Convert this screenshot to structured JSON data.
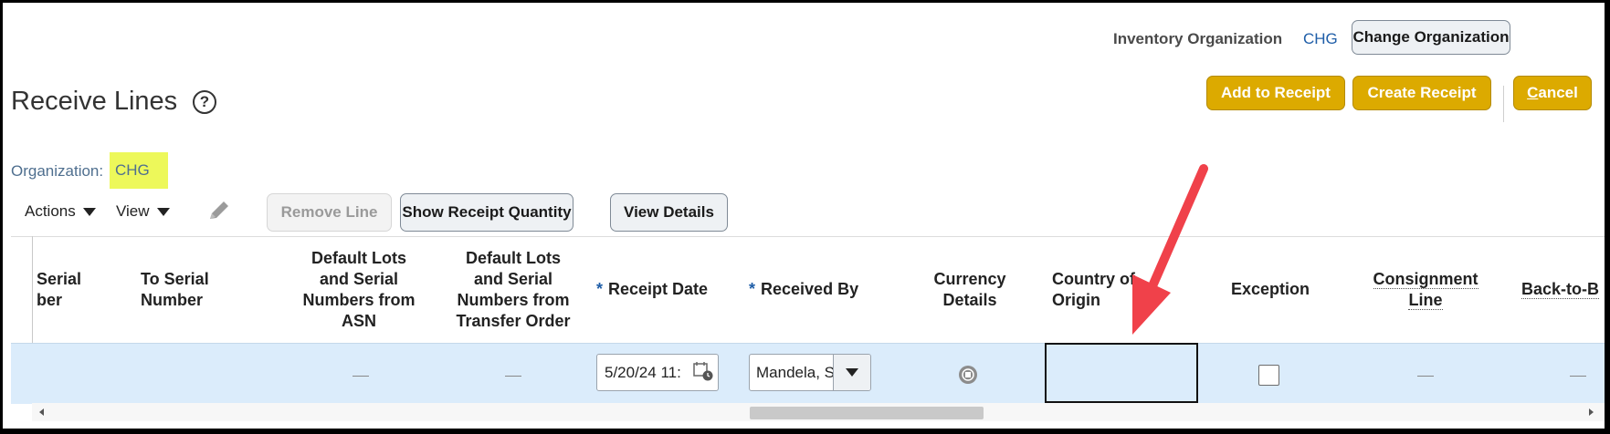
{
  "header": {
    "inventory_org_label": "Inventory Organization",
    "inventory_org_value": "CHG",
    "change_org_button": "Change Organization"
  },
  "page": {
    "title": "Receive Lines",
    "help_icon": "?",
    "org_label": "Organization:",
    "org_value": "CHG"
  },
  "actions": {
    "add_to_receipt": "Add to Receipt",
    "create_receipt": "Create Receipt",
    "cancel_first": "C",
    "cancel_rest": "ancel"
  },
  "toolbar": {
    "actions_menu": "Actions",
    "view_menu": "View",
    "edit_icon": "pencil-icon",
    "remove_line": "Remove Line",
    "show_receipt_quantity": "Show Receipt Quantity",
    "view_details": "View Details"
  },
  "table": {
    "headers": {
      "from_serial_line1": "Serial",
      "from_serial_line2": "ber",
      "to_serial": [
        "To Serial",
        "Number"
      ],
      "default_lots_asn": [
        "Default Lots",
        "and Serial",
        "Numbers from",
        "ASN"
      ],
      "default_lots_to": [
        "Default Lots",
        "and Serial",
        "Numbers from",
        "Transfer Order"
      ],
      "receipt_date": "Receipt Date",
      "received_by": "Received By",
      "currency_details": [
        "Currency",
        "Details"
      ],
      "country_of_origin": [
        "Country of",
        "Origin"
      ],
      "exception": "Exception",
      "consignment_line": [
        "Consignment",
        "Line"
      ],
      "back_to_back": "Back-to-B",
      "required_marker": "*"
    },
    "row": {
      "default_lots_asn": "—",
      "default_lots_to": "—",
      "receipt_date": "5/20/24 11:",
      "received_by": "Mandela, S",
      "country_of_origin": "",
      "exception_checked": false,
      "consignment_line": "—",
      "back_to_back": "—"
    }
  },
  "colors": {
    "gold_button": "#dcaa00",
    "selected_row": "#dbecfb",
    "highlight": "#edf85a",
    "annotation_arrow": "#f0414a",
    "link_blue": "#1f5ea8"
  }
}
